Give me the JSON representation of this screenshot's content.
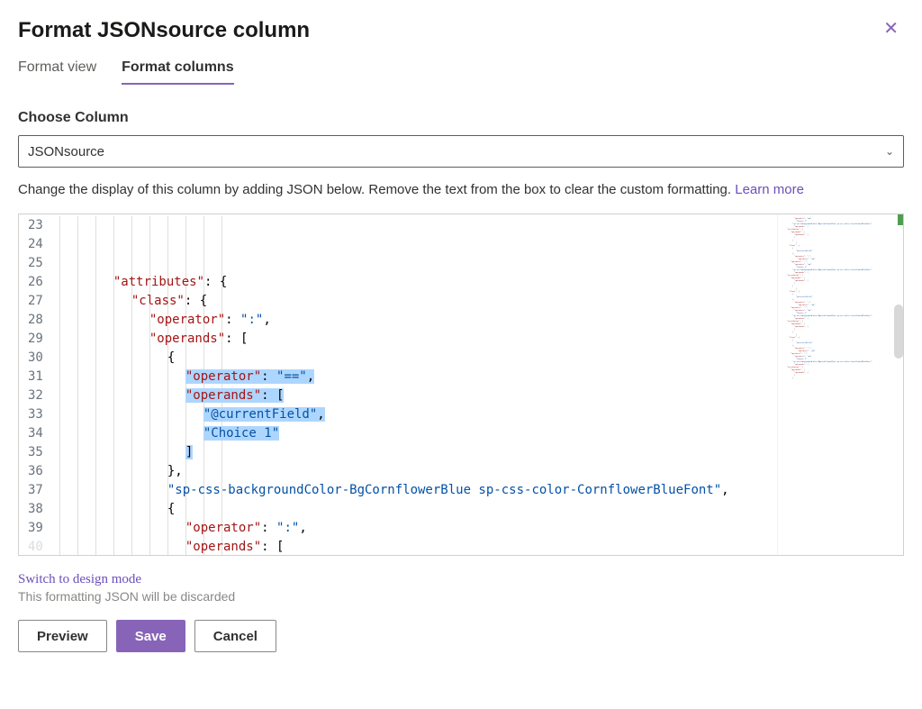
{
  "header": {
    "title": "Format JSONsource column"
  },
  "tabs": {
    "view": "Format view",
    "columns": "Format columns"
  },
  "chooseColumn": {
    "label": "Choose Column",
    "selected": "JSONsource"
  },
  "description": {
    "text": "Change the display of this column by adding JSON below. Remove the text from the box to clear the custom formatting. ",
    "linkText": "Learn more"
  },
  "editor": {
    "startLine": 23,
    "lines": [
      {
        "n": 23,
        "indent": 3,
        "sel": false,
        "tokens": [
          [
            "key",
            "\"attributes\""
          ],
          [
            "punc",
            ": {"
          ]
        ]
      },
      {
        "n": 24,
        "indent": 4,
        "sel": false,
        "tokens": [
          [
            "key",
            "\"class\""
          ],
          [
            "punc",
            ": {"
          ]
        ]
      },
      {
        "n": 25,
        "indent": 5,
        "sel": false,
        "tokens": [
          [
            "key",
            "\"operator\""
          ],
          [
            "punc",
            ": "
          ],
          [
            "str",
            "\":\""
          ],
          [
            "punc",
            ","
          ]
        ]
      },
      {
        "n": 26,
        "indent": 5,
        "sel": false,
        "tokens": [
          [
            "key",
            "\"operands\""
          ],
          [
            "punc",
            ": ["
          ]
        ]
      },
      {
        "n": 27,
        "indent": 6,
        "sel": false,
        "tokens": [
          [
            "punc",
            "{"
          ]
        ]
      },
      {
        "n": 28,
        "indent": 7,
        "sel": true,
        "tokens": [
          [
            "key",
            "\"operator\""
          ],
          [
            "punc",
            ": "
          ],
          [
            "str",
            "\"==\""
          ],
          [
            "punc",
            ","
          ]
        ]
      },
      {
        "n": 29,
        "indent": 7,
        "sel": true,
        "tokens": [
          [
            "key",
            "\"operands\""
          ],
          [
            "punc",
            ": ["
          ]
        ]
      },
      {
        "n": 30,
        "indent": 8,
        "sel": true,
        "tokens": [
          [
            "str",
            "\"@currentField\""
          ],
          [
            "punc",
            ","
          ]
        ]
      },
      {
        "n": 31,
        "indent": 8,
        "sel": true,
        "tokens": [
          [
            "str",
            "\"Choice 1\""
          ]
        ]
      },
      {
        "n": 32,
        "indent": 7,
        "sel": true,
        "tokens": [
          [
            "punc",
            "]"
          ]
        ]
      },
      {
        "n": 33,
        "indent": 6,
        "sel": false,
        "tokens": [
          [
            "punc",
            "},"
          ]
        ]
      },
      {
        "n": 34,
        "indent": 6,
        "sel": false,
        "tokens": [
          [
            "str",
            "\"sp-css-backgroundColor-BgCornflowerBlue sp-css-color-CornflowerBlueFont\""
          ],
          [
            "punc",
            ","
          ]
        ]
      },
      {
        "n": 35,
        "indent": 6,
        "sel": false,
        "tokens": [
          [
            "punc",
            "{"
          ]
        ]
      },
      {
        "n": 36,
        "indent": 7,
        "sel": false,
        "tokens": [
          [
            "key",
            "\"operator\""
          ],
          [
            "punc",
            ": "
          ],
          [
            "str",
            "\":\""
          ],
          [
            "punc",
            ","
          ]
        ]
      },
      {
        "n": 37,
        "indent": 7,
        "sel": false,
        "tokens": [
          [
            "key",
            "\"operands\""
          ],
          [
            "punc",
            ": ["
          ]
        ]
      },
      {
        "n": 38,
        "indent": 8,
        "sel": false,
        "tokens": [
          [
            "punc",
            "{"
          ]
        ]
      },
      {
        "n": 39,
        "indent": 9,
        "sel": false,
        "tokens": [
          [
            "key",
            "\"operator\""
          ],
          [
            "punc",
            ": "
          ],
          [
            "str",
            "\"==\""
          ],
          [
            "punc",
            ","
          ]
        ]
      }
    ],
    "faintLine": "40"
  },
  "designMode": {
    "link": "Switch to design mode",
    "hint": "This formatting JSON will be discarded"
  },
  "buttons": {
    "preview": "Preview",
    "save": "Save",
    "cancel": "Cancel"
  }
}
